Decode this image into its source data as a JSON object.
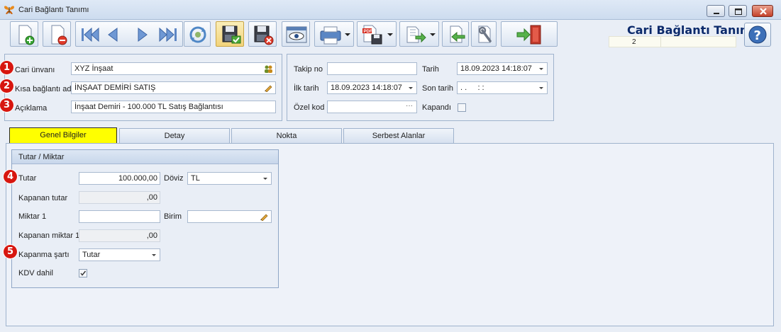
{
  "window": {
    "title": "Cari Bağlantı Tanımı"
  },
  "header": {
    "title": "Cari Bağlantı Tanımı",
    "record_number": "2"
  },
  "toolbar": {
    "buttons": [
      {
        "name": "new-record",
        "icon": "new-document-plus-icon"
      },
      {
        "name": "delete-record",
        "icon": "delete-document-minus-icon"
      },
      {
        "name": "first-record",
        "icon": "first-icon"
      },
      {
        "name": "previous-record",
        "icon": "previous-icon"
      },
      {
        "name": "next-record",
        "icon": "next-icon"
      },
      {
        "name": "last-record",
        "icon": "last-icon"
      },
      {
        "name": "refresh",
        "icon": "refresh-icon"
      },
      {
        "name": "save",
        "icon": "save-check-icon"
      },
      {
        "name": "cancel-save",
        "icon": "save-cancel-icon"
      },
      {
        "name": "preview",
        "icon": "preview-eye-icon"
      },
      {
        "name": "print",
        "icon": "printer-icon"
      },
      {
        "name": "export-pdf",
        "icon": "pdf-save-icon"
      },
      {
        "name": "import",
        "icon": "import-icon"
      },
      {
        "name": "back",
        "icon": "back-arrow-icon"
      },
      {
        "name": "settings",
        "icon": "wrench-icon"
      },
      {
        "name": "exit",
        "icon": "exit-door-icon"
      }
    ]
  },
  "main_form": {
    "cari_unvani": {
      "label": "Cari ünvanı",
      "value": "XYZ İnşaat"
    },
    "kisa_baglanti_adi": {
      "label": "Kısa bağlantı adı",
      "value": "İNŞAAT DEMİRİ SATIŞ"
    },
    "aciklama": {
      "label": "Açıklama",
      "value": "İnşaat Demiri - 100.000 TL Satış Bağlantısı"
    }
  },
  "right_form": {
    "takip_no": {
      "label": "Takip no",
      "value": ""
    },
    "tarih": {
      "label": "Tarih",
      "value": "18.09.2023 14:18:07"
    },
    "ilk_tarih": {
      "label": "İlk tarih",
      "value": "18.09.2023 14:18:07"
    },
    "son_tarih": {
      "label": "Son tarih",
      "value": ". .     : :"
    },
    "ozel_kod": {
      "label": "Özel kod",
      "value": ""
    },
    "kapandi": {
      "label": "Kapandı",
      "checked": false
    }
  },
  "tabs": [
    {
      "label": "Genel Bilgiler",
      "active": true
    },
    {
      "label": "Detay",
      "active": false
    },
    {
      "label": "Nokta",
      "active": false
    },
    {
      "label": "Serbest Alanlar",
      "active": false
    }
  ],
  "tutar_miktar": {
    "title": "Tutar / Miktar",
    "tutar": {
      "label": "Tutar",
      "value": "100.000,00"
    },
    "doviz": {
      "label": "Döviz",
      "value": "TL"
    },
    "kapanan_tutar": {
      "label": "Kapanan tutar",
      "value": ",00"
    },
    "miktar1": {
      "label": "Miktar 1",
      "value": ""
    },
    "birim": {
      "label": "Birim",
      "value": ""
    },
    "kapanan_miktar1": {
      "label": "Kapanan miktar 1",
      "value": ",00"
    },
    "kapanma_sarti": {
      "label": "Kapanma şartı",
      "value": "Tutar"
    },
    "kdv_dahil": {
      "label": "KDV dahil",
      "checked": true
    }
  },
  "badges": [
    "1",
    "2",
    "3",
    "4",
    "5"
  ],
  "colors": {
    "badge": "#d7160f",
    "active_tab": "#ffff00",
    "header_title": "#0c2a6b"
  }
}
